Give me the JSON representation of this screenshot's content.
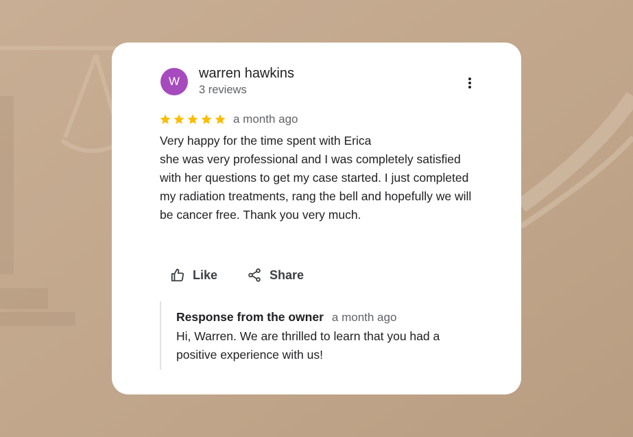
{
  "colors": {
    "background": "#c3a88d",
    "card": "#ffffff",
    "avatar": "#a64bbd",
    "star": "#fbbc04",
    "text_primary": "#202124",
    "text_secondary": "#5f6368"
  },
  "review": {
    "author": {
      "avatar_letter": "W",
      "name": "warren hawkins",
      "reviews_count": "3 reviews"
    },
    "menu_icon": "more-vert-icon",
    "rating": {
      "stars": 5,
      "max": 5
    },
    "date": "a month ago",
    "text": "Very happy for the time spent with Erica\nshe was very professional and I was completely satisfied with her questions to get my case started. I just completed my radiation treatments, rang the bell and hopefully we will be cancer free. Thank you very much.",
    "actions": {
      "like_label": "Like",
      "like_icon": "thumbs-up-icon",
      "share_label": "Share",
      "share_icon": "share-icon"
    }
  },
  "owner_response": {
    "title": "Response from the owner",
    "date": "a month ago",
    "text": "Hi, Warren. We are thrilled to learn that you had a positive experience with us!"
  }
}
